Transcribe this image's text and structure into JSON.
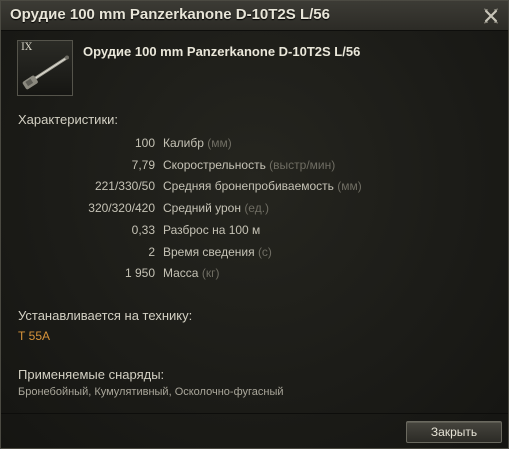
{
  "window": {
    "title": "Орудие 100 mm Panzerkanone D-10T2S L/56",
    "close_icon": "close-x-icon"
  },
  "module": {
    "tier": "IX",
    "icon": "gun-icon",
    "name": "Орудие 100 mm Panzerkanone D-10T2S L/56"
  },
  "characteristics": {
    "heading": "Характеристики:",
    "rows": [
      {
        "value": "100",
        "label": "Калибр",
        "unit": "(мм)"
      },
      {
        "value": "7,79",
        "label": "Скорострельность",
        "unit": "(выстр/мин)"
      },
      {
        "value": "221/330/50",
        "label": "Средняя бронепробиваемость",
        "unit": "(мм)"
      },
      {
        "value": "320/320/420",
        "label": "Средний урон",
        "unit": "(ед.)"
      },
      {
        "value": "0,33",
        "label": "Разброс на 100 м",
        "unit": ""
      },
      {
        "value": "2",
        "label": "Время сведения",
        "unit": "(с)"
      },
      {
        "value": "1 950",
        "label": "Масса",
        "unit": "(кг)"
      }
    ]
  },
  "installed_on": {
    "heading": "Устанавливается на технику:",
    "vehicles": "Т 55А",
    "color": "#d8943a"
  },
  "shells": {
    "heading": "Применяемые снаряды:",
    "list": "Бронебойный, Кумулятивный, Осколочно-фугасный"
  },
  "footer": {
    "close_label": "Закрыть"
  }
}
